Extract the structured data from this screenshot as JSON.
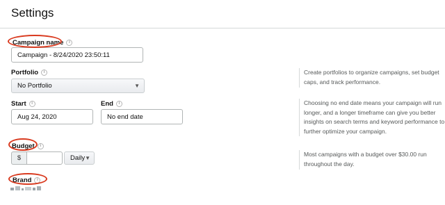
{
  "page": {
    "title": "Settings"
  },
  "campaign_name": {
    "label": "Campaign name",
    "value": "Campaign - 8/24/2020 23:50:11"
  },
  "portfolio": {
    "label": "Portfolio",
    "selected": "No Portfolio",
    "help": "Create portfolios to organize campaigns, set budget caps, and track performance."
  },
  "dates": {
    "start_label": "Start",
    "start_value": "Aug 24, 2020",
    "end_label": "End",
    "end_placeholder": "No end date",
    "help": "Choosing no end date means your campaign will run longer, and a longer timeframe can give you better insights on search terms and keyword performance to further optimize your campaign."
  },
  "budget": {
    "label": "Budget",
    "currency_symbol": "$",
    "value": "",
    "period_selected": "Daily",
    "help": "Most campaigns with a budget over $30.00 run throughout the day."
  },
  "brand": {
    "label": "Brand"
  },
  "icons": {
    "info": "info-icon",
    "dropdown": "chevron-down-icon"
  },
  "colors": {
    "annotation_oval": "#d93a1f"
  }
}
